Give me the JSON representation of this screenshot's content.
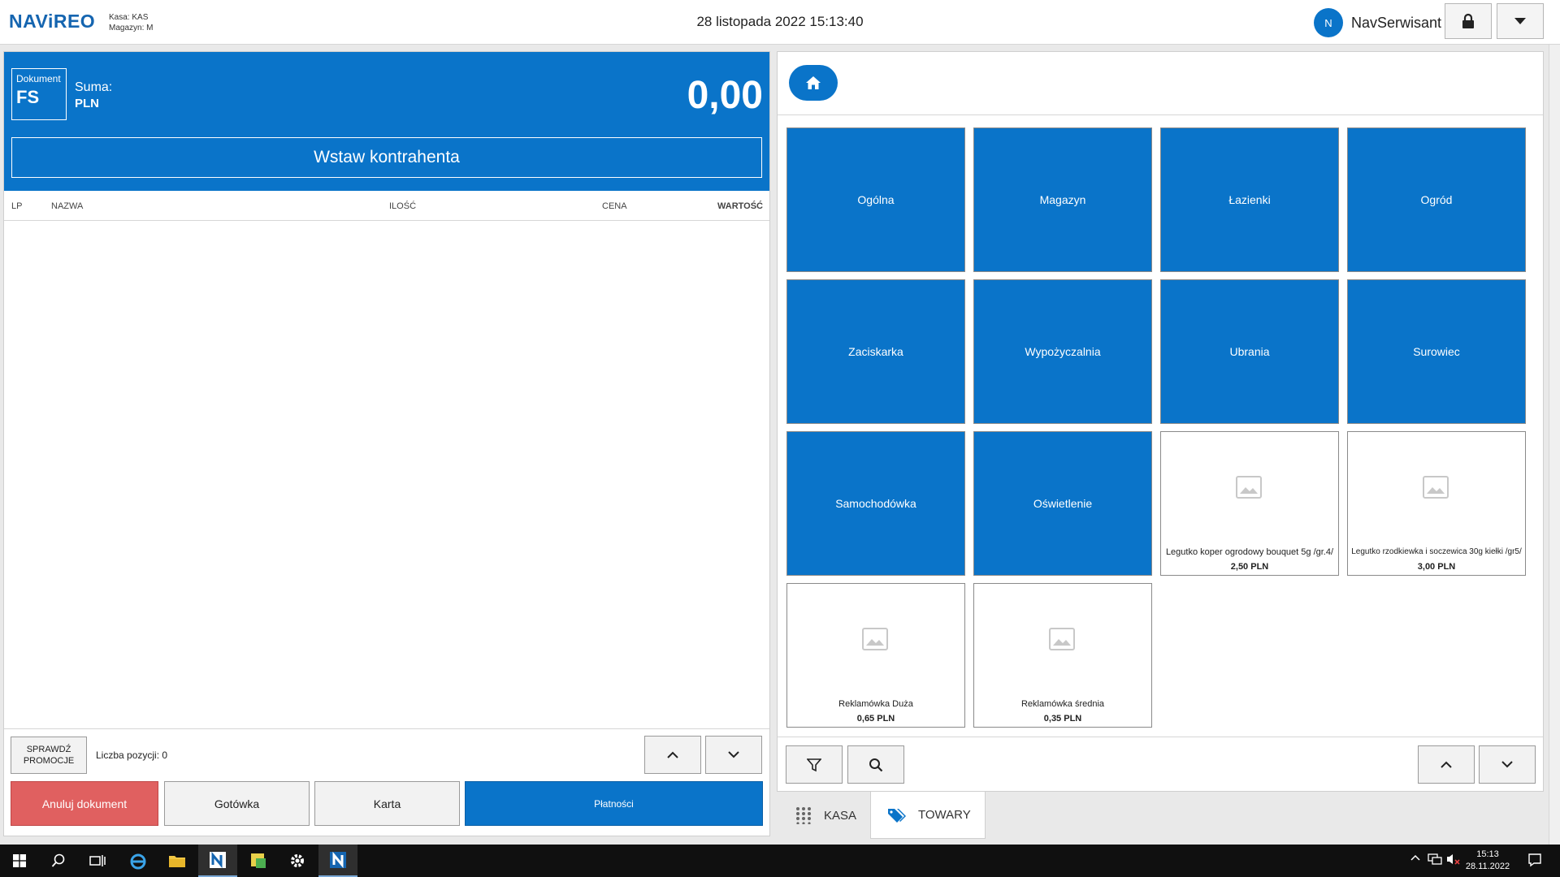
{
  "header": {
    "logo": "NAViREO",
    "kasa_label": "Kasa:",
    "kasa_value": "KAS",
    "magazyn_label": "Magazyn:",
    "magazyn_value": "M",
    "datetime": "28 listopada 2022 15:13:40",
    "user_initial": "N",
    "user_name": "NavSerwisant"
  },
  "document": {
    "label": "Dokument",
    "type": "FS",
    "sum_label": "Suma:",
    "currency": "PLN",
    "total": "0,00",
    "contractor_button": "Wstaw kontrahenta"
  },
  "table": {
    "columns": [
      "LP",
      "NAZWA",
      "ILOŚĆ",
      "CENA",
      "WARTOŚĆ"
    ],
    "rows": []
  },
  "left_footer": {
    "promo_line1": "SPRAWDŹ",
    "promo_line2": "PROMOCJE",
    "count_label": "Liczba pozycji: 0",
    "cancel": "Anuluj dokument",
    "cash": "Gotówka",
    "card": "Karta",
    "payments": "Płatności"
  },
  "tiles": [
    {
      "type": "category",
      "label": "Ogólna"
    },
    {
      "type": "category",
      "label": "Magazyn"
    },
    {
      "type": "category",
      "label": "Łazienki"
    },
    {
      "type": "category",
      "label": "Ogród"
    },
    {
      "type": "category",
      "label": "Zaciskarka"
    },
    {
      "type": "category",
      "label": "Wypożyczalnia"
    },
    {
      "type": "category",
      "label": "Ubrania"
    },
    {
      "type": "category",
      "label": "Surowiec"
    },
    {
      "type": "category",
      "label": "Samochodówka"
    },
    {
      "type": "category",
      "label": "Oświetlenie"
    },
    {
      "type": "product",
      "label": "Legutko koper ogrodowy bouquet 5g /gr.4/",
      "price": "2,50 PLN"
    },
    {
      "type": "product",
      "label": "Legutko rzodkiewka i soczewica 30g kiełki /gr5/",
      "price": "3,00 PLN"
    },
    {
      "type": "product",
      "label": "Reklamówka Duża",
      "price": "0,65 PLN"
    },
    {
      "type": "product",
      "label": "Reklamówka średnia",
      "price": "0,35 PLN"
    }
  ],
  "tabs": {
    "kasa": "KASA",
    "towary": "TOWARY"
  },
  "taskbar": {
    "time": "15:13",
    "date": "28.11.2022"
  },
  "colors": {
    "accent": "#0a74c9",
    "cancel": "#e06060",
    "payments": "#0a74c9"
  }
}
